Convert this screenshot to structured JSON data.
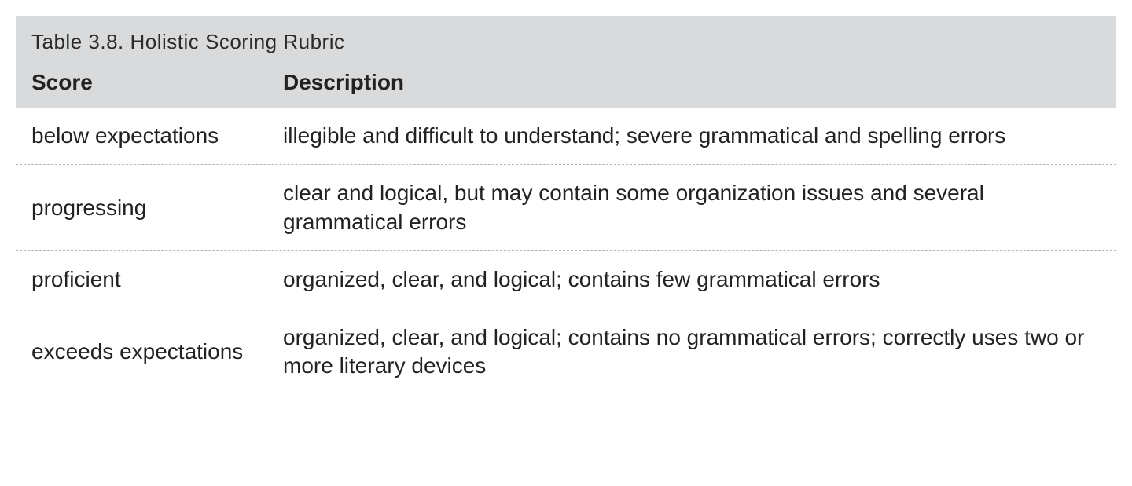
{
  "table": {
    "title": "Table 3.8. Holistic Scoring Rubric",
    "headers": {
      "score": "Score",
      "description": "Description"
    },
    "rows": [
      {
        "score": "below expectations",
        "description": "illegible and difficult to understand; severe grammatical and spelling errors"
      },
      {
        "score": "progressing",
        "description": "clear and logical, but may contain some organization issues and several grammatical errors"
      },
      {
        "score": "proficient",
        "description": "organized, clear, and logical; contains few grammatical errors"
      },
      {
        "score": "exceeds expectations",
        "description": "organized, clear, and logical; contains no grammatical errors; correctly uses two or more literary devices"
      }
    ]
  },
  "chart_data": {
    "type": "table",
    "title": "Table 3.8. Holistic Scoring Rubric",
    "columns": [
      "Score",
      "Description"
    ],
    "rows": [
      [
        "below expectations",
        "illegible and difficult to understand; severe grammatical and spelling errors"
      ],
      [
        "progressing",
        "clear and logical, but may contain some organization issues and several grammatical errors"
      ],
      [
        "proficient",
        "organized, clear, and logical; contains few grammatical errors"
      ],
      [
        "exceeds expectations",
        "organized, clear, and logical; contains no grammatical errors; correctly uses two or more literary devices"
      ]
    ]
  }
}
